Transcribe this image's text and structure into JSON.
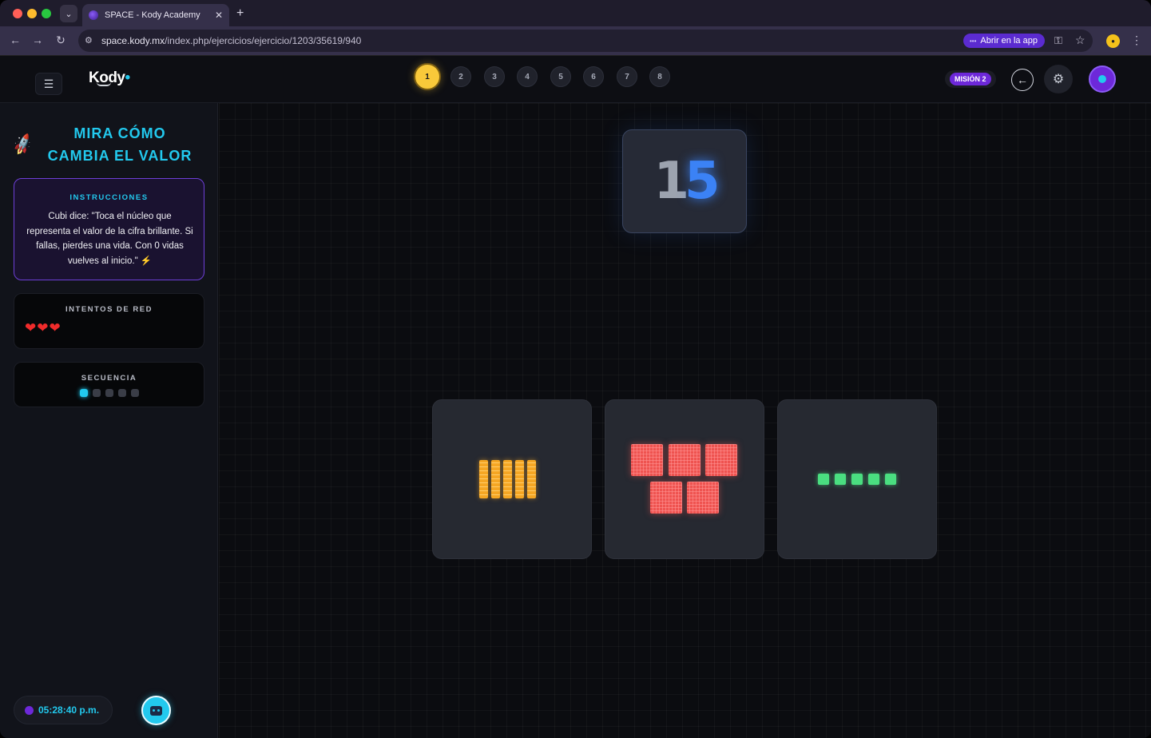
{
  "browser": {
    "tab_title": "SPACE - Kody Academy",
    "url_host": "space.kody.mx",
    "url_path": "/index.php/ejercicios/ejercicio/1203/35619/940",
    "open_app_label": "Abrir en la app"
  },
  "header": {
    "logo": "Kody",
    "steps": [
      "1",
      "2",
      "3",
      "4",
      "5",
      "6",
      "7",
      "8"
    ],
    "active_step": 1,
    "mission_label": "MISIÓN 2"
  },
  "sidebar": {
    "title_line1": "MIRA CÓMO",
    "title_line2": "CAMBIA EL VALOR",
    "instructions_heading": "INSTRUCCIONES",
    "instructions_text": "Cubi dice: \"Toca el núcleo que representa el valor de la cifra brillante. Si fallas, pierdes una vida. Con 0 vidas vuelves al inicio.\" ⚡",
    "lives_heading": "INTENTOS DE RED",
    "lives": 3,
    "sequence_heading": "SECUENCIA",
    "sequence_total": 5,
    "sequence_current": 1,
    "clock": "05:28:40 p.m."
  },
  "main": {
    "number_tens": "1",
    "number_units": "5",
    "options": [
      {
        "kind": "rods",
        "count": 5,
        "color": "#f5a623"
      },
      {
        "kind": "flats",
        "count": 5,
        "color": "#ef5350"
      },
      {
        "kind": "units",
        "count": 5,
        "color": "#4ade80"
      }
    ]
  },
  "colors": {
    "accent": "#22c9ee",
    "purple": "#6d28d9",
    "active_step": "#f9c93a"
  }
}
